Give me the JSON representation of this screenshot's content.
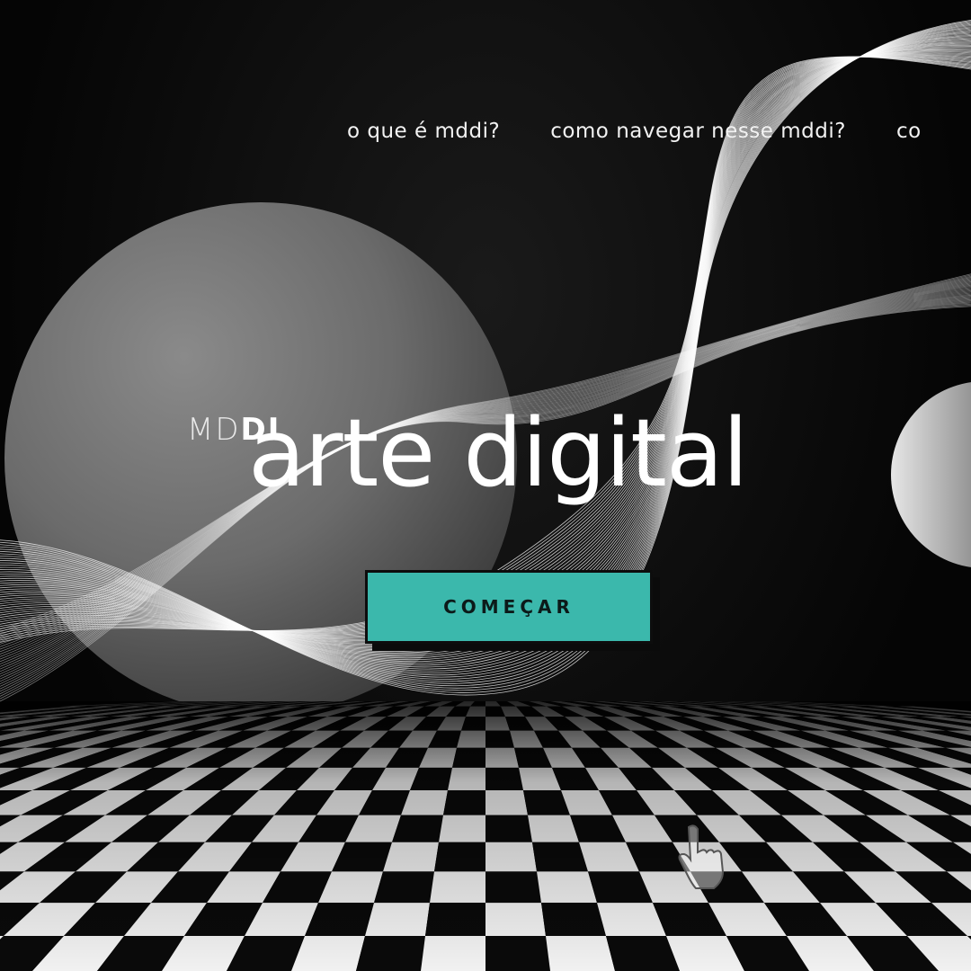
{
  "nav": {
    "items": [
      {
        "label": "o que é mddi?"
      },
      {
        "label": "como navegar nesse mddi?"
      },
      {
        "label": "co"
      }
    ]
  },
  "hero": {
    "logo_text": "MDDI",
    "headline": "arte digital",
    "cta_label": "COMEÇAR"
  },
  "colors": {
    "accent": "#3bb8ac",
    "background": "#000000",
    "text": "#ffffff"
  },
  "icons": {
    "pointer": "hand-pointer-icon"
  }
}
